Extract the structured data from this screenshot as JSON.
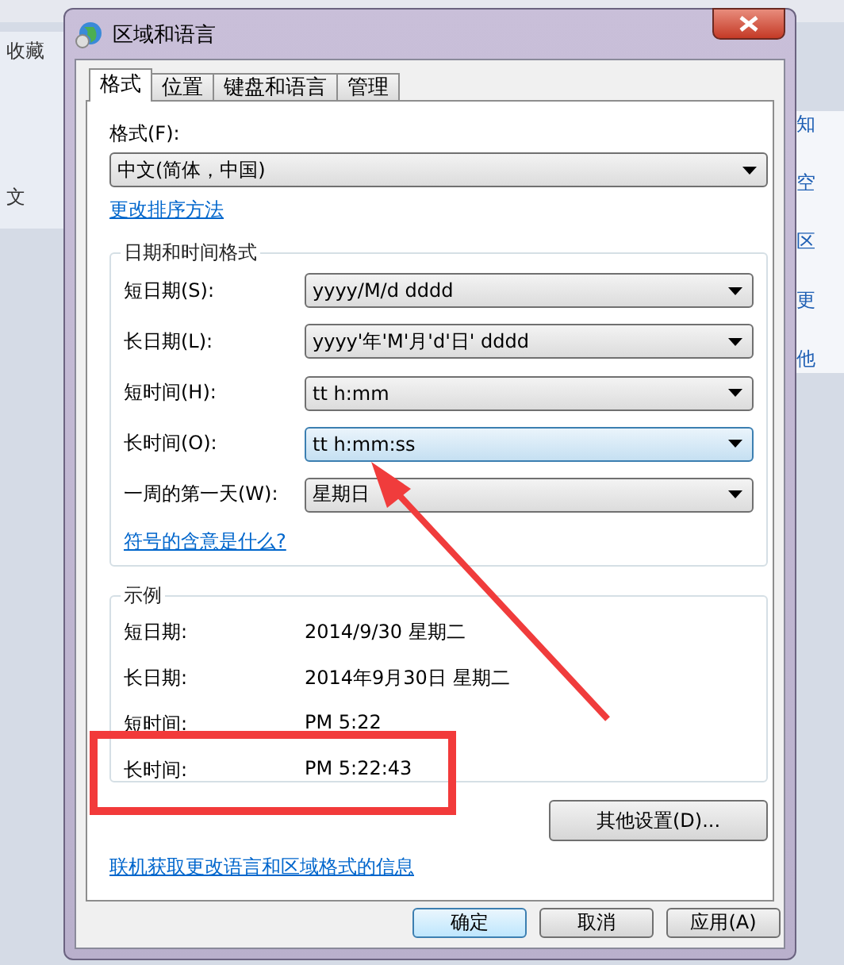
{
  "background": {
    "left_texts": [
      "收藏",
      "文"
    ],
    "right_texts": [
      "知",
      "空",
      "区",
      "更",
      "他"
    ]
  },
  "window": {
    "title": "区域和语言"
  },
  "tabs": [
    {
      "label": "格式",
      "selected": true
    },
    {
      "label": "位置",
      "selected": false
    },
    {
      "label": "键盘和语言",
      "selected": false
    },
    {
      "label": "管理",
      "selected": false
    }
  ],
  "format": {
    "label": "格式(F):",
    "value": "中文(简体，中国)"
  },
  "sort_link": "更改排序方法",
  "date_time_formats": {
    "title": "日期和时间格式",
    "rows": [
      {
        "label": "短日期(S):",
        "value": "yyyy/M/d dddd",
        "focused": false
      },
      {
        "label": "长日期(L):",
        "value": "yyyy'年'M'月'd'日' dddd",
        "focused": false
      },
      {
        "label": "短时间(H):",
        "value": "tt h:mm",
        "focused": false
      },
      {
        "label": "长时间(O):",
        "value": "tt h:mm:ss",
        "focused": true
      },
      {
        "label": "一周的第一天(W):",
        "value": "星期日",
        "focused": false
      }
    ],
    "link": "符号的含意是什么?"
  },
  "examples": {
    "title": "示例",
    "rows": [
      {
        "label": "短日期:",
        "value": "2014/9/30 星期二"
      },
      {
        "label": "长日期:",
        "value": "2014年9月30日 星期二"
      },
      {
        "label": "短时间:",
        "value": "PM 5:22"
      },
      {
        "label": "长时间:",
        "value": "PM 5:22:43"
      }
    ]
  },
  "more_button": "其他设置(D)...",
  "online_link": "联机获取更改语言和区域格式的信息",
  "buttons": [
    {
      "label": "确定",
      "default": true
    },
    {
      "label": "取消",
      "default": false
    },
    {
      "label": "应用(A)",
      "default": false
    }
  ]
}
